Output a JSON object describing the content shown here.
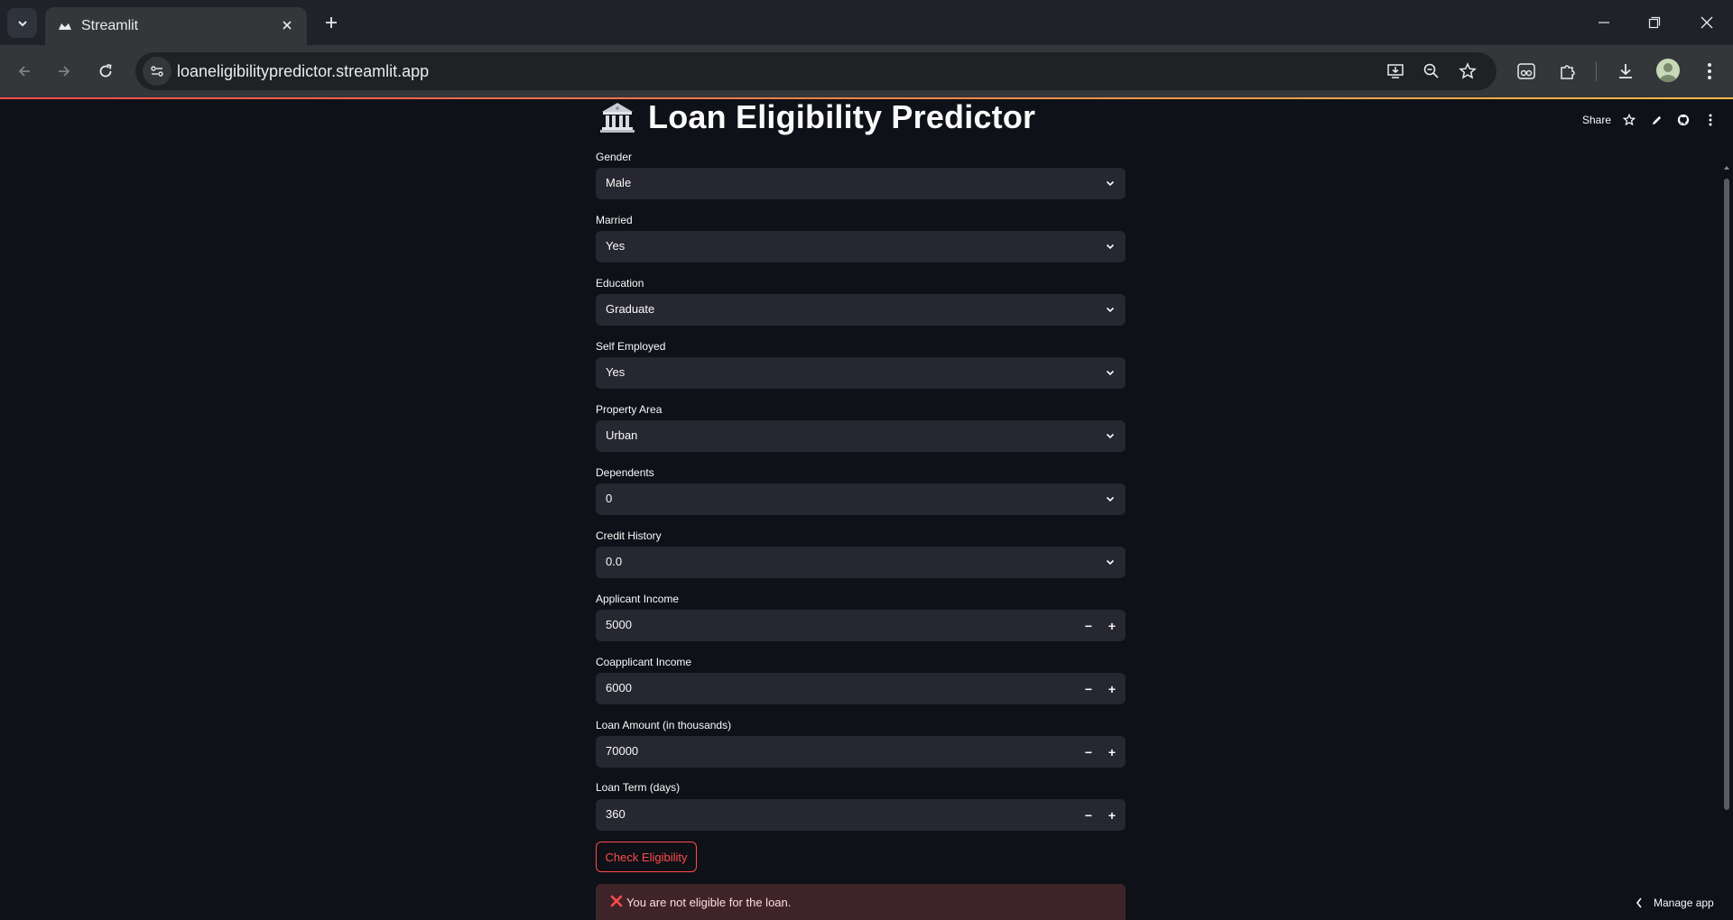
{
  "browser": {
    "tab_title": "Streamlit",
    "url": "loaneligibilitypredictor.streamlit.app",
    "icons": [
      "tab-list-icon",
      "streamlit-favicon",
      "close-icon",
      "new-tab-icon",
      "minimize-icon",
      "restore-icon",
      "window-close-icon",
      "back-icon",
      "forward-icon",
      "reload-icon",
      "site-info-icon",
      "install-app-icon",
      "zoom-out-icon",
      "bookmark-star-icon",
      "extension-icon",
      "puzzle-icon",
      "download-icon",
      "profile-avatar",
      "menu-icon"
    ]
  },
  "header": {
    "share_label": "Share",
    "icons": [
      "star-icon",
      "edit-icon",
      "github-icon",
      "more-icon"
    ]
  },
  "app": {
    "title": "Loan Eligibility Predictor",
    "title_emoji": "bank-building-icon",
    "fields": {
      "gender": {
        "label": "Gender",
        "value": "Male"
      },
      "married": {
        "label": "Married",
        "value": "Yes"
      },
      "education": {
        "label": "Education",
        "value": "Graduate"
      },
      "self_employed": {
        "label": "Self Employed",
        "value": "Yes"
      },
      "property_area": {
        "label": "Property Area",
        "value": "Urban"
      },
      "dependents": {
        "label": "Dependents",
        "value": "0"
      },
      "credit_history": {
        "label": "Credit History",
        "value": "0.0"
      },
      "applicant_income": {
        "label": "Applicant Income",
        "value": "5000"
      },
      "coapplicant_income": {
        "label": "Coapplicant Income",
        "value": "6000"
      },
      "loan_amount": {
        "label": "Loan Amount (in thousands)",
        "value": "70000"
      },
      "loan_term": {
        "label": "Loan Term (days)",
        "value": "360"
      }
    },
    "stepper": {
      "minus": "−",
      "plus": "+"
    },
    "check_button": "Check Eligibility",
    "result_message": "You are not eligible for the loan.",
    "manage_app": "Manage app"
  },
  "colors": {
    "background": "#0e1117",
    "input_bg": "#262730",
    "accent": "#ff4b4b",
    "error_bg": "#3e2428"
  }
}
